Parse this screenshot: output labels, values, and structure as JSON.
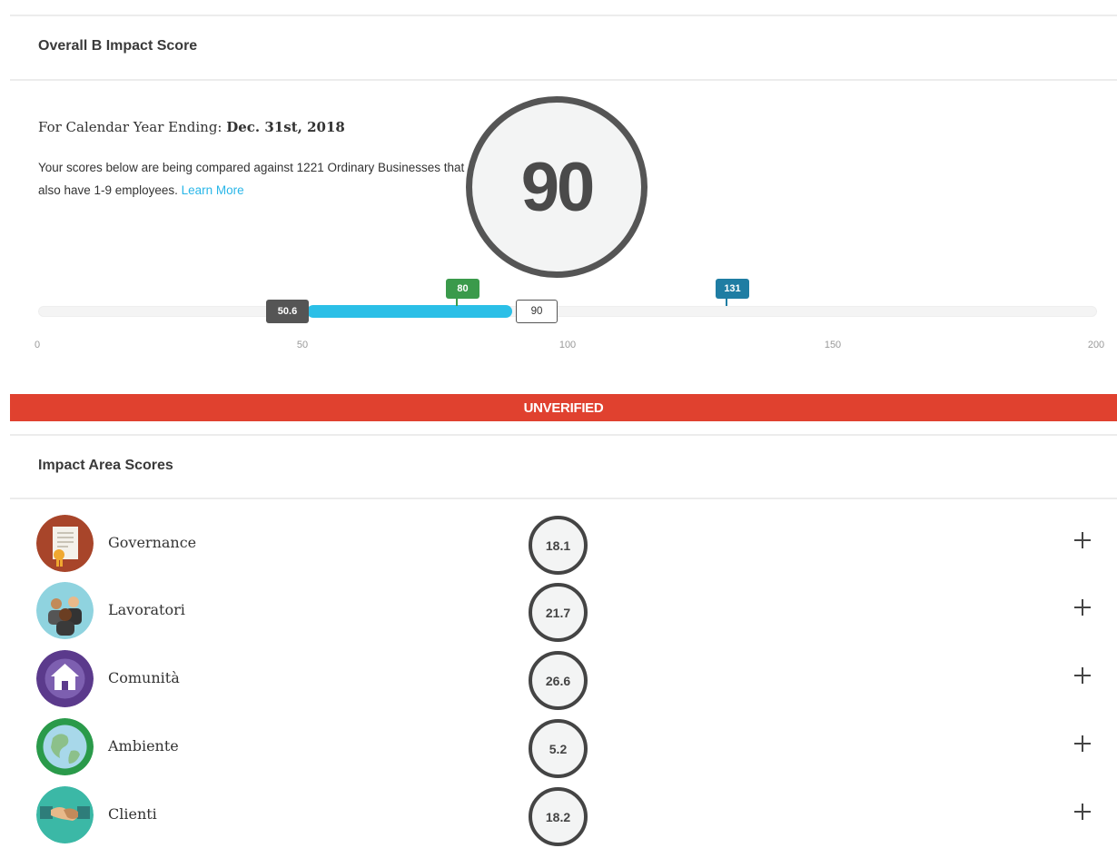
{
  "overall": {
    "title": "Overall B Impact Score",
    "year_prefix": "For Calendar Year Ending: ",
    "year_date": "Dec. 31st, 2018",
    "compare_text": "Your scores below are being compared against 1221 Ordinary Businesses that also have 1-9 employees.",
    "learn_more": "Learn More",
    "score": "90"
  },
  "scale": {
    "min": 0,
    "max": 200,
    "ticks": [
      "0",
      "50",
      "100",
      "150",
      "200"
    ],
    "start_label": "50.6",
    "median_label": "80",
    "bcorp_label": "131",
    "score_label": "90",
    "start_value": 50.6,
    "median_value": 80,
    "bcorp_value": 131,
    "score_value": 90
  },
  "status": {
    "label": "UNVERIFIED",
    "color": "#e0412f"
  },
  "areas": {
    "title": "Impact Area Scores",
    "items": [
      {
        "name": "Governance",
        "score": "18.1",
        "icon": "certificate-icon",
        "color": "#a8452a"
      },
      {
        "name": "Lavoratori",
        "score": "21.7",
        "icon": "workers-icon",
        "color": "#8fd3df"
      },
      {
        "name": "Comunità",
        "score": "26.6",
        "icon": "community-house-icon",
        "color": "#5b3a8c"
      },
      {
        "name": "Ambiente",
        "score": "5.2",
        "icon": "globe-icon",
        "color": "#2a9a4a"
      },
      {
        "name": "Clienti",
        "score": "18.2",
        "icon": "handshake-icon",
        "color": "#3bb8a6"
      }
    ]
  },
  "colors": {
    "accent": "#2bbfe7",
    "median": "#3a9a4b",
    "bcorp": "#1f7da3",
    "link": "#29b6e8"
  }
}
